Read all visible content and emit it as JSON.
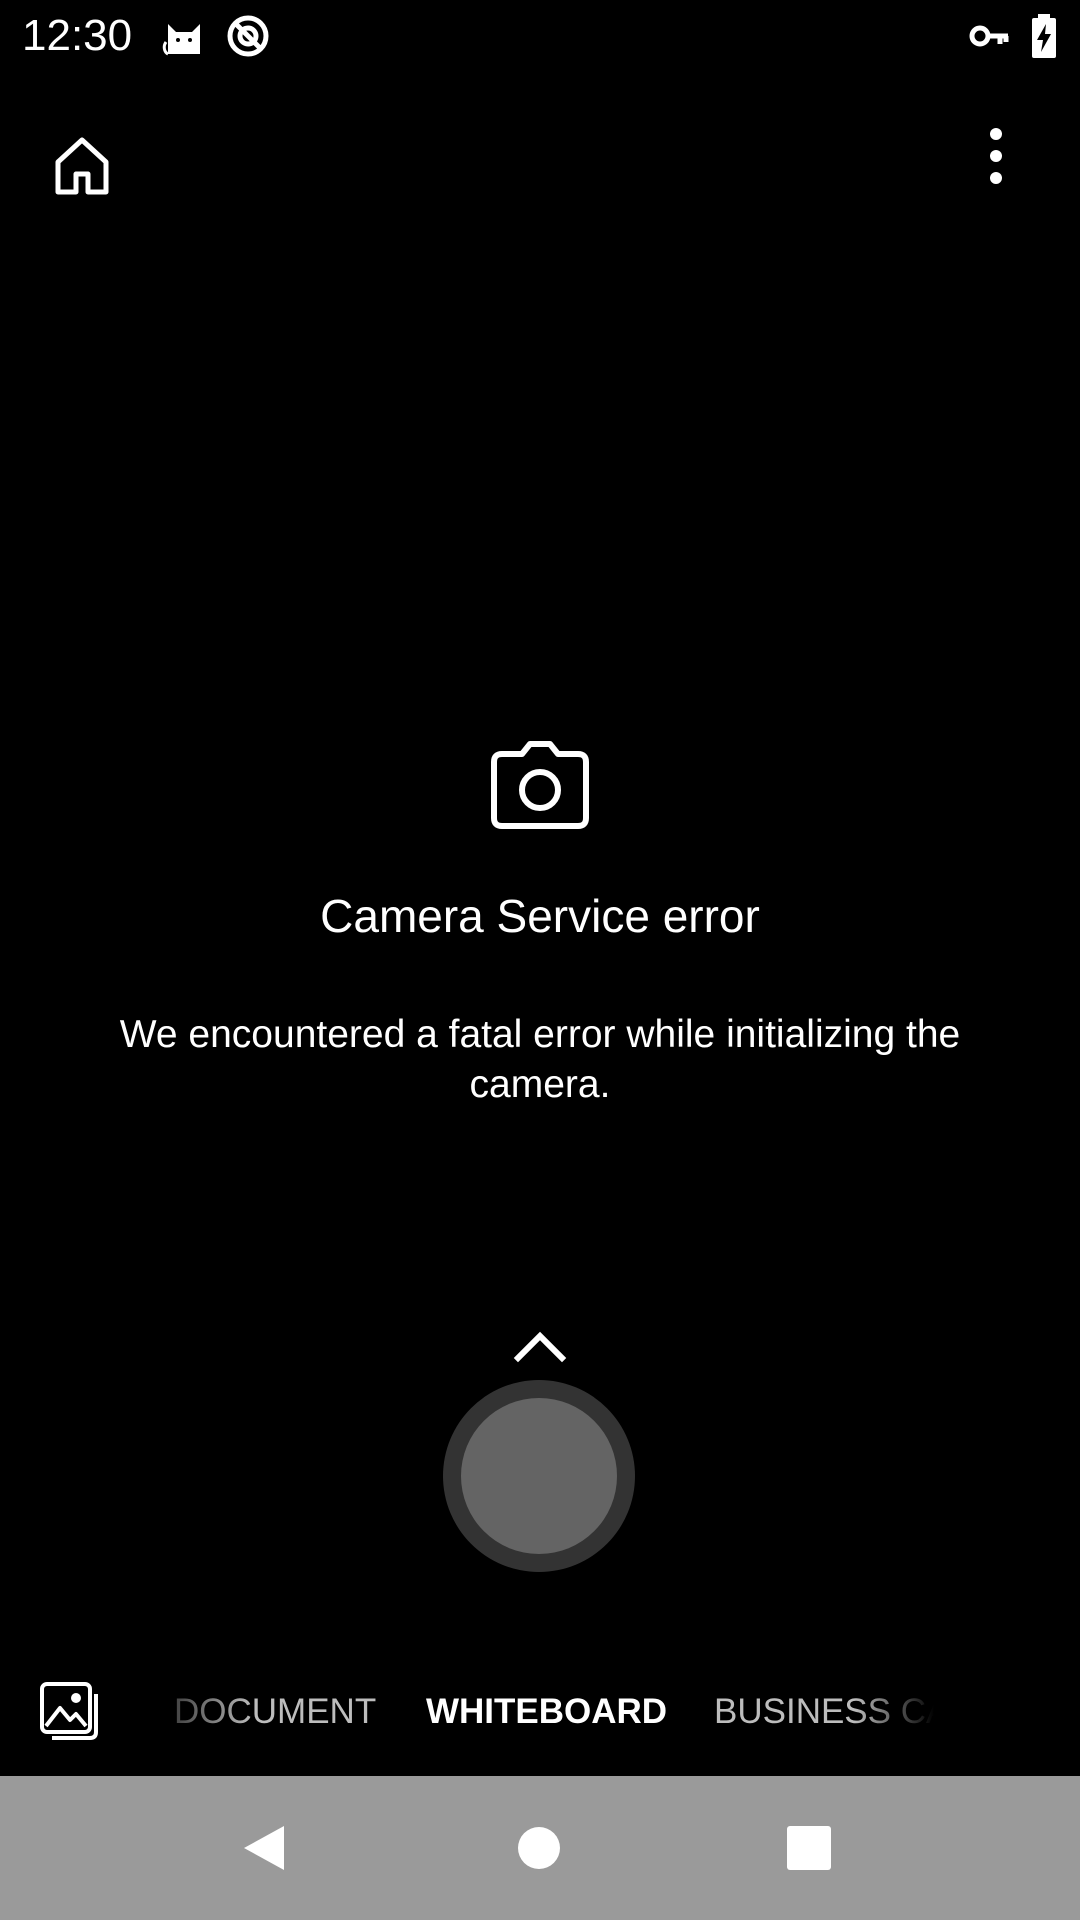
{
  "status_bar": {
    "time": "12:30",
    "left_icons": [
      "cat-notification-icon",
      "do-not-disturb-icon"
    ],
    "right_icons": [
      "vpn-key-icon",
      "battery-charging-icon"
    ]
  },
  "toolbar": {
    "home_icon": "home-icon",
    "more_icon": "more-vert-icon"
  },
  "error": {
    "icon": "camera-icon",
    "title": "Camera Service error",
    "message": "We encountered a fatal error while initializing the camera."
  },
  "capture": {
    "expand_icon": "chevron-up-icon",
    "shutter_icon": "shutter-button"
  },
  "modes": {
    "gallery_icon": "gallery-icon",
    "items": [
      "DOCUMENT",
      "WHITEBOARD",
      "BUSINESS CARD"
    ],
    "selected": "WHITEBOARD"
  },
  "nav": {
    "back_icon": "back-triangle-icon",
    "home_icon": "home-circle-icon",
    "recents_icon": "recents-square-icon"
  },
  "colors": {
    "background": "#000000",
    "text": "#ffffff",
    "inactive_mode": "#bdbdbd",
    "shutter_ring": "#333333",
    "shutter_fill": "#646464",
    "nav_bar": "#9a9a9a"
  }
}
